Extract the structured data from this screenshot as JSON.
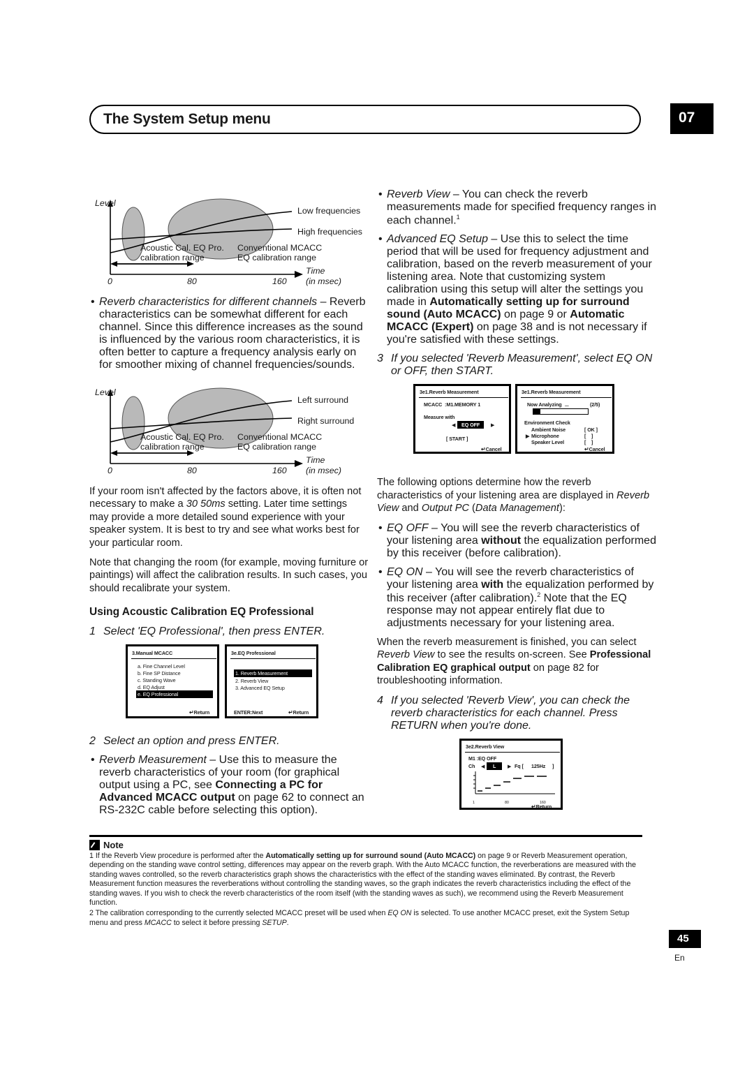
{
  "header": {
    "title": "The System Setup menu",
    "chapter": "07"
  },
  "figures": [
    {
      "axis_y_label": "Level",
      "axis_x_label": "Time",
      "axis_x_unit": "(in msec)",
      "ticks": [
        "0",
        "80",
        "160"
      ],
      "curve_labels": [
        "Low frequencies",
        "High frequencies"
      ],
      "range_label_left": "Acoustic Cal. EQ Pro.\ncalibration range",
      "range_label_right": "Conventional MCACC\nEQ calibration range"
    },
    {
      "axis_y_label": "Level",
      "axis_x_label": "Time",
      "axis_x_unit": "(in msec)",
      "ticks": [
        "0",
        "80",
        "160"
      ],
      "curve_labels": [
        "Left surround",
        "Right surround"
      ],
      "range_label_left": "Acoustic Cal. EQ Pro.\ncalibration range",
      "range_label_right": "Conventional MCACC\nEQ calibration range"
    }
  ],
  "left_column": {
    "bullet_reverb_channels_title": "Reverb characteristics for different channels",
    "bullet_reverb_channels_body": " – Reverb characteristics can be somewhat different for each channel. Since this difference increases as the sound is influenced by the various room characteristics, it is often better to capture a frequency analysis early on for smoother mixing of channel frequencies/sounds.",
    "para_room_pre": "If your room isn't affected by the factors above, it is often not necessary to make a ",
    "para_room_italic": "30 50ms",
    "para_room_post": " setting. Later time settings may provide a more detailed sound experience with your speaker system. It is best to try and see what works best for your particular room.",
    "para_changing_room": "Note that changing the room (for example, moving furniture or paintings) will affect the calibration results. In such cases, you should recalibrate your system.",
    "section_heading": "Using Acoustic Calibration EQ Professional",
    "step1_num": "1",
    "step1_text": "Select 'EQ Professional', then press ENTER.",
    "step2_num": "2",
    "step2_text": "Select an option and press ENTER.",
    "bullet_reverb_measurement_title": "Reverb Measurement",
    "bullet_reverb_measurement_body_1": " – Use this to measure the reverb characteristics of your room (for graphical output using a PC, see ",
    "bullet_reverb_measurement_bold": "Connecting a PC for Advanced MCACC output",
    "bullet_reverb_measurement_body_2": " on page 62 to connect an RS-232C cable before selecting this option)."
  },
  "lcd_manual_mcacc": {
    "title": "3.Manual MCACC",
    "items": [
      "a. Fine Channel Level",
      "b. Fine SP Distance",
      "c. Standing Wave",
      "d. EQ Adjust",
      "e. EQ Professional"
    ],
    "selected_index": 4,
    "footer_return": "Return"
  },
  "lcd_eq_professional": {
    "title": "3e.EQ Professional",
    "items": [
      "1. Reverb Measurement",
      "2. Reverb View",
      "3. Advanced EQ Setup"
    ],
    "selected_index": 0,
    "footer_enter": "ENTER:Next",
    "footer_return": "Return"
  },
  "lcd_reverb_measurement_start": {
    "title": "3e1.Reverb Measurement",
    "mcacc_line": "MCACC  :M1.MEMORY 1",
    "measure_label": "Measure with",
    "eq_value": "EQ OFF",
    "left_arrow": "◀",
    "right_arrow": "▶",
    "start_button": "[ START ]",
    "footer_cancel": "Cancel"
  },
  "lcd_reverb_measurement_progress": {
    "title": "3e1.Reverb Measurement",
    "now_analyzing": "Now Analyzing",
    "dots": "...",
    "step_counter": "(2/5)",
    "section_label": "Environment Check",
    "rows": [
      {
        "label": "Ambient Noise",
        "value": "[ OK ]",
        "cursor": false
      },
      {
        "label": "Microphone",
        "value": "[    ]",
        "cursor": true
      },
      {
        "label": "Speaker Level",
        "value": "[    ]",
        "cursor": false
      }
    ],
    "footer_cancel": "Cancel"
  },
  "lcd_reverb_view": {
    "title": "3e2.Reverb View",
    "preset_line": "M1 :EQ OFF",
    "channel_label": "Ch",
    "channel_value": "L",
    "left_arrow": "◀",
    "right_arrow": "▶",
    "freq_label": "Fq [",
    "freq_value": "125Hz",
    "freq_close": "]",
    "x_ticks": [
      "1",
      "80",
      "160"
    ],
    "footer_return": "Return"
  },
  "right_column": {
    "bullet_reverb_view_title": "Reverb View",
    "bullet_reverb_view_body": " – You can check the reverb measurements made for specified frequency ranges in each channel.",
    "bullet_reverb_view_footnote": "1",
    "bullet_adv_eq_title": "Advanced EQ Setup",
    "bullet_adv_eq_body_1": " – Use this to select the time period that will be used for frequency adjustment and calibration, based on the reverb measurement of your listening area. Note that customizing system calibration using this setup will alter the settings you made in ",
    "bullet_adv_eq_bold_1": "Automatically setting up for surround sound (Auto MCACC)",
    "bullet_adv_eq_body_2": " on page 9 or ",
    "bullet_adv_eq_bold_2": "Automatic MCACC (Expert)",
    "bullet_adv_eq_body_3": " on page 38 and is not necessary if you're satisfied with these settings.",
    "step3_num": "3",
    "step3_text": "If you selected 'Reverb Measurement', select EQ ON or OFF, then START.",
    "para_options_pre": "The following options determine how the reverb characteristics of your listening area are displayed in ",
    "para_options_it1": "Reverb View",
    "para_options_mid": " and ",
    "para_options_it2": "Output PC",
    "para_options_mid2": " (",
    "para_options_it3": "Data Management",
    "para_options_post": "):",
    "bullet_eqoff_title": "EQ OFF",
    "bullet_eqoff_body_1": " – You will see the reverb characteristics of your listening area ",
    "bullet_eqoff_bold": "without",
    "bullet_eqoff_body_2": " the equalization performed by this receiver (before calibration).",
    "bullet_eqon_title": "EQ ON",
    "bullet_eqon_body_1": " – You will see the reverb characteristics of your listening area ",
    "bullet_eqon_bold": "with",
    "bullet_eqon_body_2": " the equalization performed by this receiver (after calibration).",
    "bullet_eqon_footnote": "2",
    "bullet_eqon_body_3": " Note that the EQ response may not appear entirely flat due to adjustments necessary for your listening area.",
    "para_finished_1": "When the reverb measurement is finished, you can select ",
    "para_finished_it": "Reverb View",
    "para_finished_2": " to see the results on-screen. See ",
    "para_finished_bold": "Professional Calibration EQ graphical output",
    "para_finished_3": " on page 82 for troubleshooting information.",
    "step4_num": "4",
    "step4_text": "If you selected 'Reverb View', you can check the reverb characteristics for each channel. Press RETURN when you're done."
  },
  "note": {
    "label": "Note",
    "footnote1_pre": "1 If the Reverb View procedure is performed after the ",
    "footnote1_bold": "Automatically setting up for surround sound (Auto MCACC)",
    "footnote1_post": " on page 9 or Reverb Measurement operation, depending on the standing wave control setting, differences may appear on the reverb graph. With the Auto MCACC function, the reverberations are measured with the standing waves controlled, so the reverb characteristics graph shows the characteristics with the effect of the standing waves eliminated. By contrast, the Reverb Measurement function measures the reverberations without controlling the standing waves, so the graph indicates the reverb characteristics including the effect of the standing waves. If you wish to check the reverb characteristics of the room itself (with the standing waves as such), we recommend using the Reverb Measurement function.",
    "footnote2_pre": "2 The calibration corresponding to the currently selected MCACC preset will be used when ",
    "footnote2_it1": "EQ ON",
    "footnote2_mid": " is selected. To use another MCACC preset, exit the System Setup menu and press ",
    "footnote2_it2": "MCACC",
    "footnote2_mid2": " to select it before pressing ",
    "footnote2_it3": "SETUP",
    "footnote2_post": "."
  },
  "footer": {
    "page_number": "45",
    "language": "En"
  }
}
